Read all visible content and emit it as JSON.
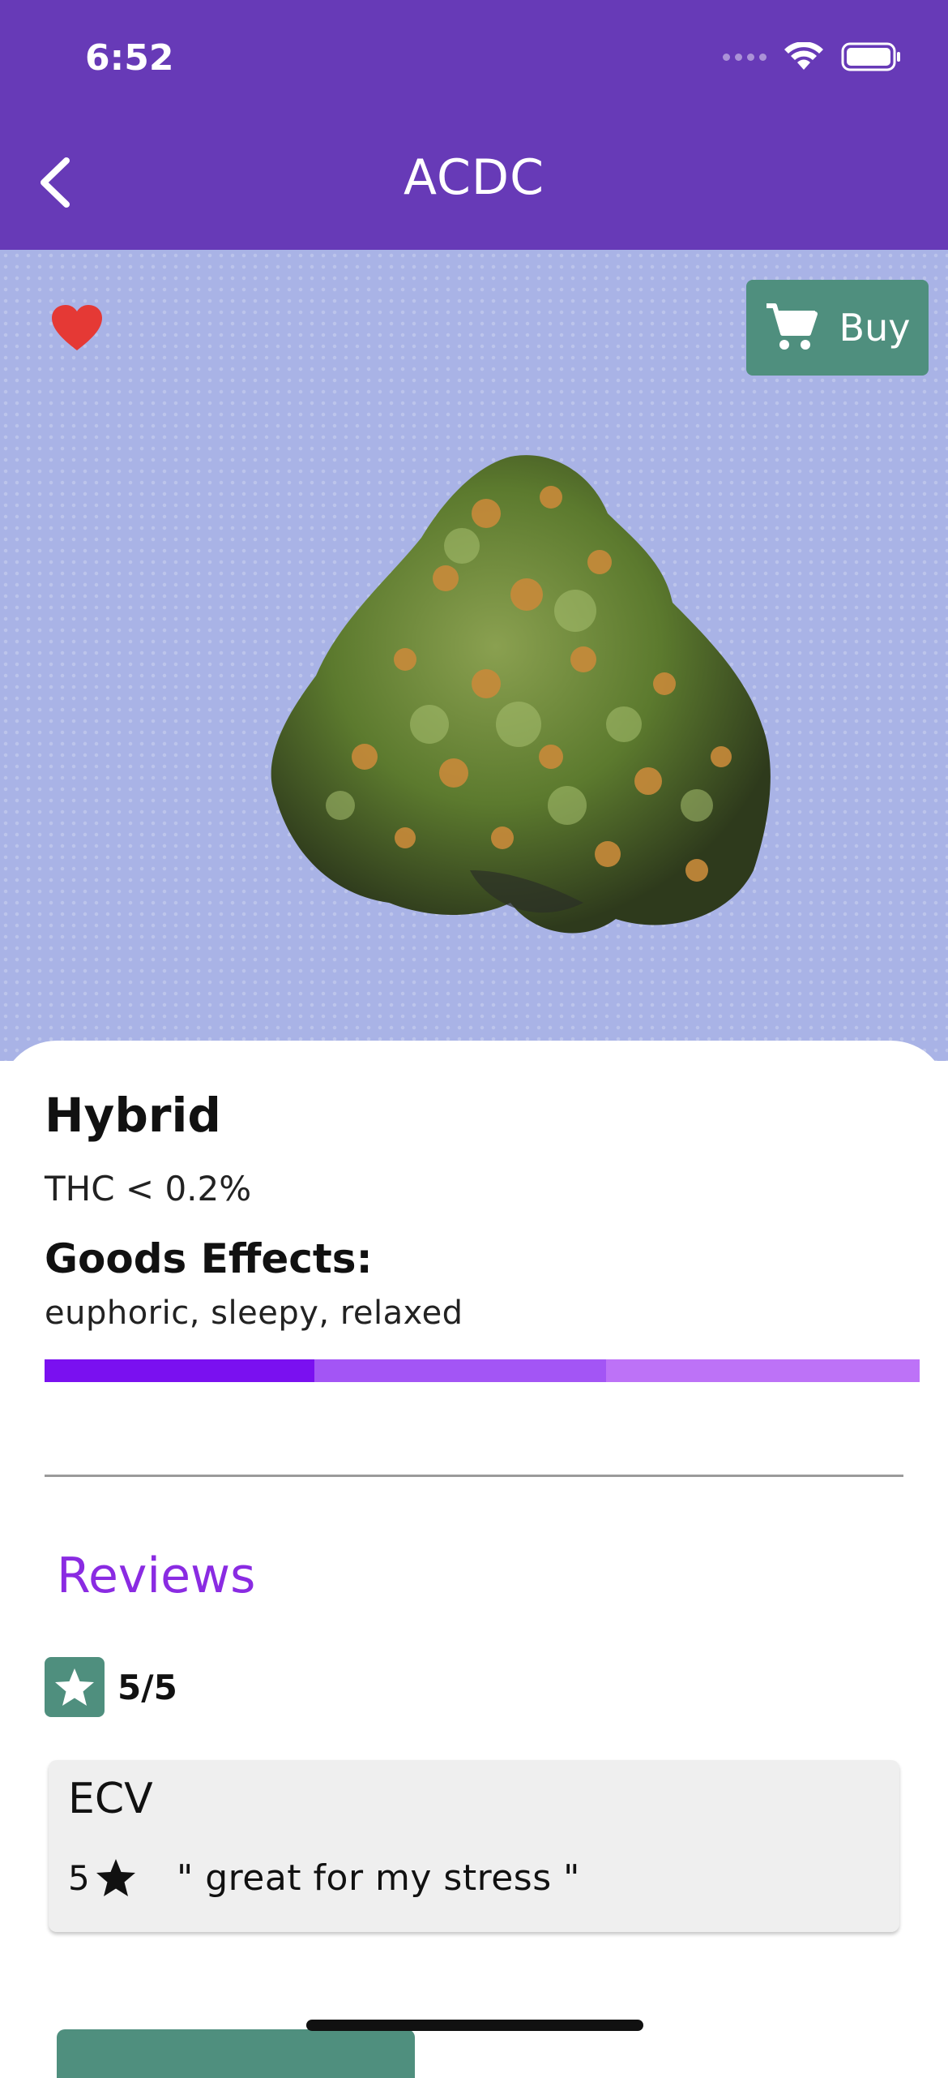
{
  "status_bar": {
    "time": "6:52"
  },
  "header": {
    "title": "ACDC",
    "back_icon": "chevron-left-icon"
  },
  "hero": {
    "favorite_icon": "heart-icon",
    "buy_label": "Buy",
    "buy_icon": "cart-icon"
  },
  "details": {
    "type": "Hybrid",
    "thc": "THC < 0.2%",
    "effects_title": "Goods Effects:",
    "effects": "euphoric, sleepy, relaxed",
    "effect_bar_colors": [
      "#7a10f0",
      "#a355f5",
      "#bd72f7"
    ]
  },
  "reviews": {
    "title": "Reviews",
    "rating": "5/5",
    "items": [
      {
        "author": "ECV",
        "stars": "5",
        "text": "\" great for my stress \""
      }
    ]
  },
  "colors": {
    "header": "#673ab7",
    "accent_green": "#4f8f7e",
    "reviews_title": "#8a2be2",
    "favorite": "#e53935"
  }
}
